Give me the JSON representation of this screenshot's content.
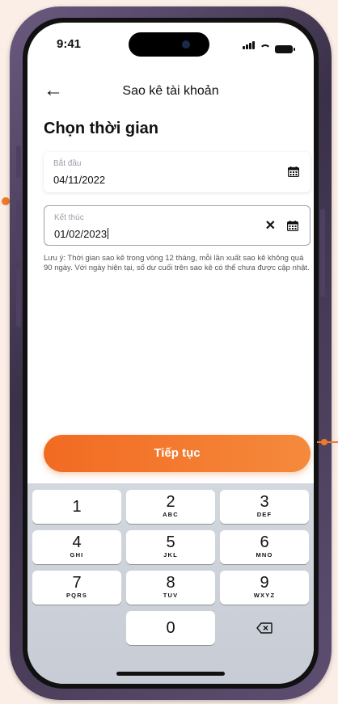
{
  "status": {
    "time": "9:41"
  },
  "header": {
    "back_icon": "arrow-left-icon",
    "title": "Sao kê tài khoản"
  },
  "section_title": "Chọn thời gian",
  "start_field": {
    "label": "Bắt đầu",
    "value": "04/11/2022",
    "icon": "calendar-icon"
  },
  "end_field": {
    "label": "Kết thúc",
    "value": "01/02/2023",
    "clear_icon": "close-icon",
    "icon": "calendar-icon"
  },
  "note": "Lưu ý: Thời gian sao kê trong vòng 12 tháng, mỗi lần xuất sao kê không quá 90 ngày. Với ngày hiện tại, số dư cuối trên sao kê có thể chưa được cập nhật.",
  "continue_button": "Tiếp tục",
  "keypad": {
    "keys": [
      {
        "num": "1",
        "letters": ""
      },
      {
        "num": "2",
        "letters": "ABC"
      },
      {
        "num": "3",
        "letters": "DEF"
      },
      {
        "num": "4",
        "letters": "GHI"
      },
      {
        "num": "5",
        "letters": "JKL"
      },
      {
        "num": "6",
        "letters": "MNO"
      },
      {
        "num": "7",
        "letters": "PQRS"
      },
      {
        "num": "8",
        "letters": "TUV"
      },
      {
        "num": "9",
        "letters": "WXYZ"
      },
      {
        "num": "0",
        "letters": ""
      }
    ],
    "delete_icon": "backspace-icon"
  },
  "colors": {
    "accent": "#f26a22",
    "background": "#fbeee6"
  }
}
